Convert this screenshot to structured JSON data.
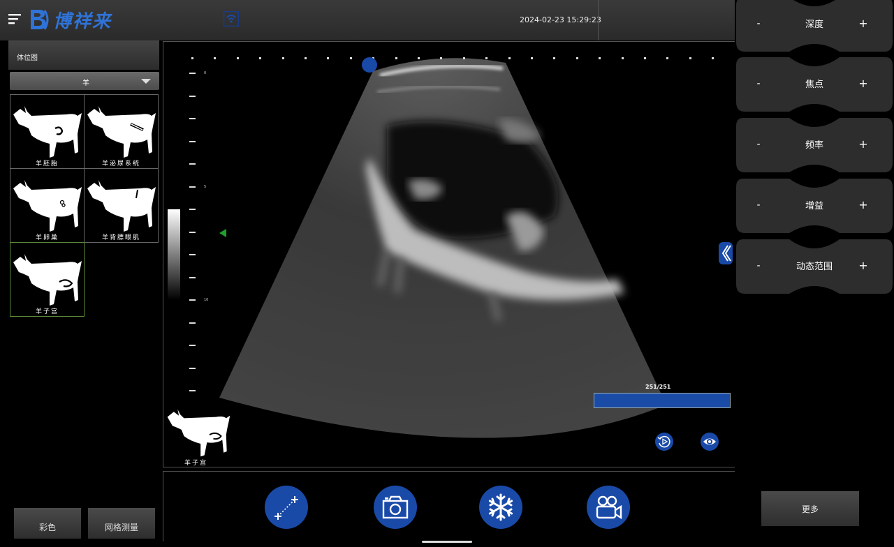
{
  "app": {
    "logo_text": "博祥来",
    "datetime": "2024-02-23 15:29:23"
  },
  "left_panel": {
    "title": "体位图",
    "species": "羊",
    "body_marks": [
      {
        "label": "羊胚胎"
      },
      {
        "label": "羊泌尿系统"
      },
      {
        "label": "羊卵巢"
      },
      {
        "label": "羊背膘眼肌"
      },
      {
        "label": "羊子宫",
        "selected": true
      }
    ],
    "buttons": {
      "color": "彩色",
      "grid_measure": "网格测量"
    }
  },
  "image": {
    "depth_scale": [
      "0",
      "5",
      "10"
    ],
    "cine_counter": "251/251",
    "bodymark_label": "羊子宫"
  },
  "right_panel": {
    "controls": [
      {
        "label": "深度",
        "minus": "-",
        "plus": "+"
      },
      {
        "label": "焦点",
        "minus": "-",
        "plus": "+"
      },
      {
        "label": "频率",
        "minus": "-",
        "plus": "+"
      },
      {
        "label": "增益",
        "minus": "-",
        "plus": "+"
      },
      {
        "label": "动态范围",
        "minus": "-",
        "plus": "+"
      }
    ],
    "more_label": "更多"
  },
  "toolbar": {
    "tools": [
      {
        "icon": "measure-icon"
      },
      {
        "icon": "camera-icon"
      },
      {
        "icon": "freeze-icon"
      },
      {
        "icon": "video-camera-icon"
      }
    ]
  },
  "colors": {
    "accent_blue": "#1a4aa8",
    "focus_green": "#1ea12a"
  }
}
